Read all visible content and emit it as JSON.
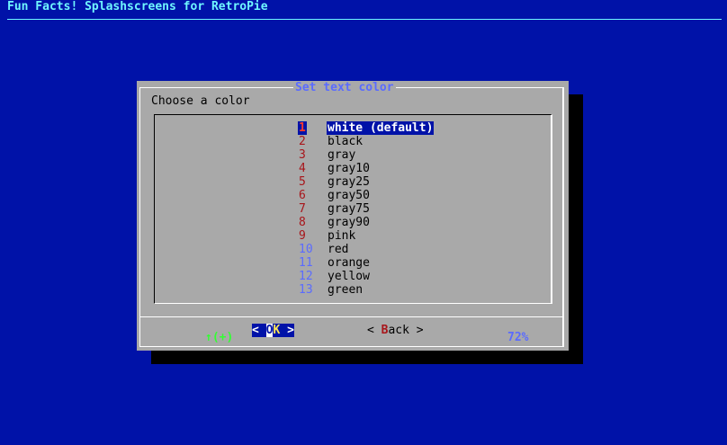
{
  "backtitle": "Fun Facts! Splashscreens for RetroPie",
  "dialog": {
    "title": "Set text color",
    "prompt": "Choose a color",
    "scroll_indicator": "↑(+)",
    "scroll_percent": "72%"
  },
  "menu": {
    "selected_index": 0,
    "items": [
      {
        "tag": "1",
        "label": "white (default)"
      },
      {
        "tag": "2",
        "label": "black"
      },
      {
        "tag": "3",
        "label": "gray"
      },
      {
        "tag": "4",
        "label": "gray10"
      },
      {
        "tag": "5",
        "label": "gray25"
      },
      {
        "tag": "6",
        "label": "gray50"
      },
      {
        "tag": "7",
        "label": "gray75"
      },
      {
        "tag": "8",
        "label": "gray90"
      },
      {
        "tag": "9",
        "label": "pink"
      },
      {
        "tag": "10",
        "label": "red"
      },
      {
        "tag": "11",
        "label": "orange"
      },
      {
        "tag": "12",
        "label": "yellow"
      },
      {
        "tag": "13",
        "label": "green"
      }
    ]
  },
  "buttons": {
    "ok": {
      "left": "< ",
      "hot": "O",
      "rest": "K",
      "right": " >"
    },
    "back": {
      "left": "< ",
      "hot": "B",
      "rest": "ack",
      "right": " >"
    }
  },
  "colors": {
    "background": "#0012a8",
    "dialog": "#a9a9a9",
    "title": "#5a6bff",
    "backtitle": "#6ff6ff",
    "tag": "#a8151a"
  }
}
